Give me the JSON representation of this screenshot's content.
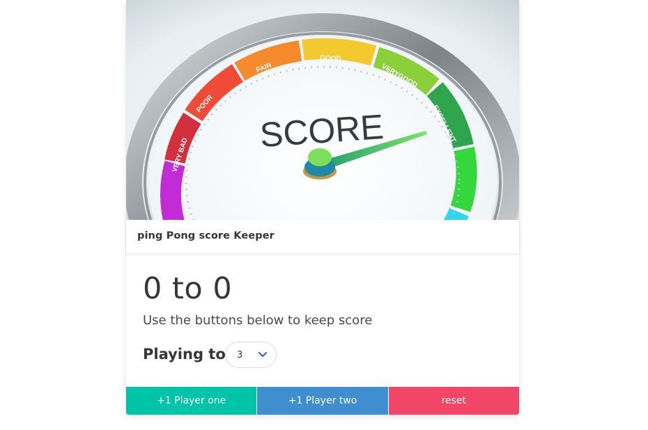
{
  "image": {
    "gauge_center_word": "SCORE",
    "segments": [
      "VERY BAD",
      "POOR",
      "FAIR",
      "GOOD",
      "VERYGOOD",
      "EXCELLENT"
    ]
  },
  "header": {
    "title": "ping Pong score Keeper"
  },
  "content": {
    "score": {
      "player_one": "0",
      "separator": "to",
      "player_two": "0"
    },
    "subtitle": "Use the buttons below to keep score",
    "playing_to_label": "Playing to",
    "playing_to_value": "3"
  },
  "footer": {
    "player_one_label": "+1 Player one",
    "player_two_label": "+1 Player two",
    "reset_label": "reset"
  },
  "colors": {
    "player_one": "#00c4a7",
    "player_two": "#3e8ed0",
    "reset": "#f14668",
    "select_arrow": "#485fc7"
  }
}
